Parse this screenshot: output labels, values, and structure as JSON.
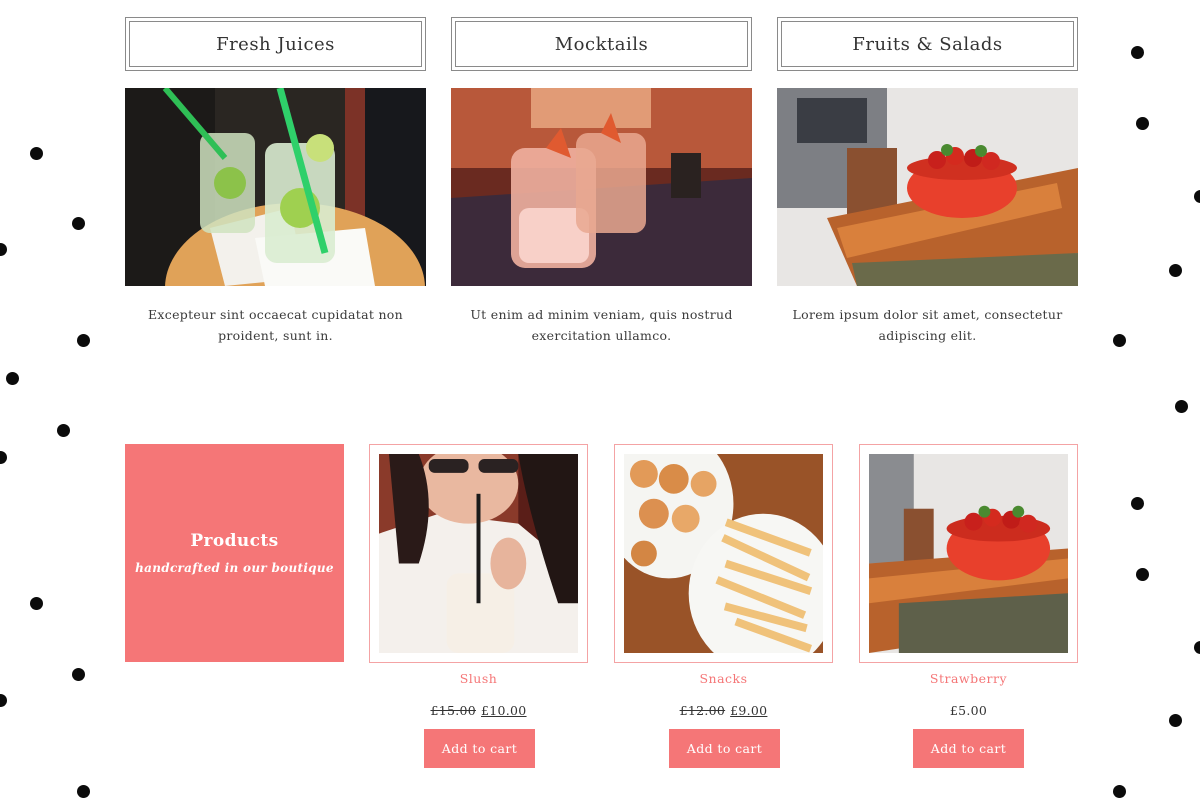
{
  "categories": [
    {
      "label": "Fresh Juices",
      "description": "Excepteur sint occaecat cupidatat non proident, sunt in.",
      "image": "juice-glasses-photo"
    },
    {
      "label": "Mocktails",
      "description": "Ut enim ad minim veniam, quis nostrud exercitation ullamco.",
      "image": "mocktail-glasses-photo"
    },
    {
      "label": "Fruits & Salads",
      "description": "Lorem ipsum dolor sit amet, consectetur adipiscing elit.",
      "image": "strawberry-bowl-photo"
    }
  ],
  "promo": {
    "title": "Products",
    "subtitle": "handcrafted in our boutique"
  },
  "products": [
    {
      "name": "Slush",
      "old_price": "£15.00",
      "price": "£10.00",
      "button": "Add to cart",
      "image": "woman-drinking-photo"
    },
    {
      "name": "Snacks",
      "old_price": "£12.00",
      "price": "£9.00",
      "button": "Add to cart",
      "image": "snacks-plates-photo"
    },
    {
      "name": "Strawberry",
      "old_price": "",
      "price": "£5.00",
      "button": "Add to cart",
      "image": "strawberry-bowl-photo"
    }
  ],
  "colors": {
    "accent": "#f57677",
    "border": "#8a8a8a",
    "card_border": "#f4a3a4",
    "text": "#333333"
  }
}
